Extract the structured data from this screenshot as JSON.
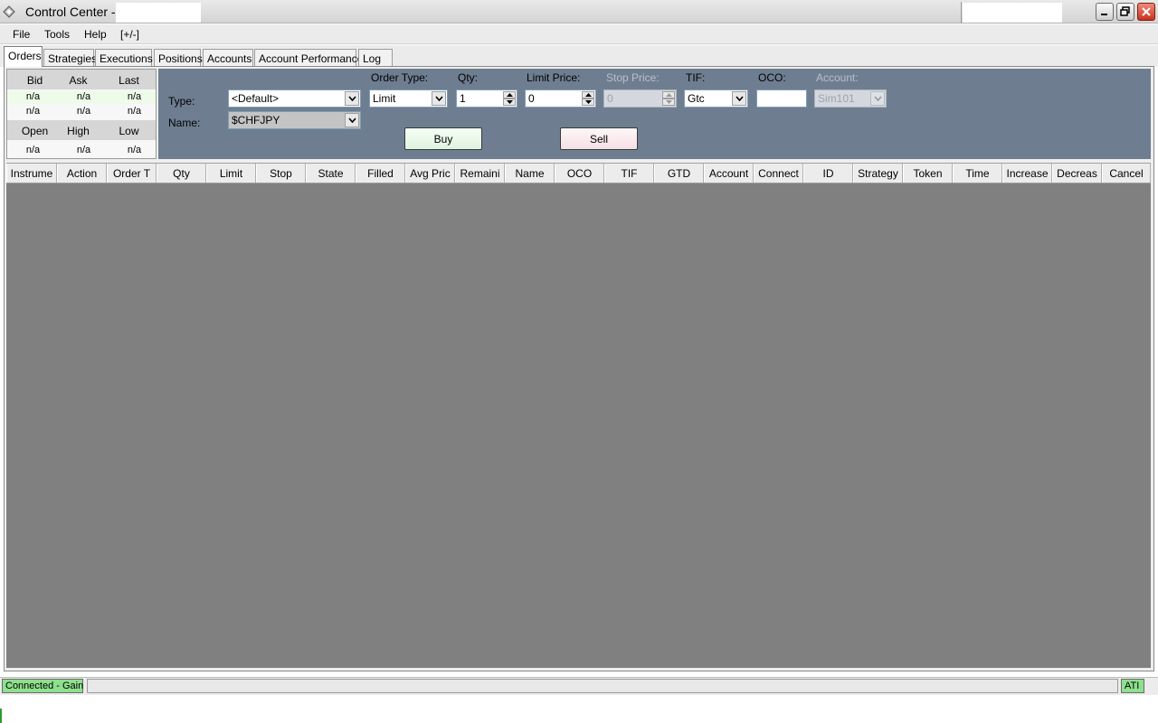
{
  "window": {
    "title": "Control Center -"
  },
  "menu": {
    "items": [
      "File",
      "Tools",
      "Help",
      "[+/-]"
    ]
  },
  "tabs": [
    "Orders",
    "Strategies",
    "Executions",
    "Positions",
    "Accounts",
    "Account Performance",
    "Log"
  ],
  "market": {
    "headers_top": [
      "Bid",
      "Ask",
      "Last"
    ],
    "row1": [
      "n/a",
      "n/a",
      "n/a"
    ],
    "row2": [
      "n/a",
      "n/a",
      "n/a"
    ],
    "headers_bottom": [
      "Open",
      "High",
      "Low"
    ],
    "row3": [
      "n/a",
      "n/a",
      "n/a"
    ]
  },
  "order_entry": {
    "type_label": "Type:",
    "type_value": "<Default>",
    "name_label": "Name:",
    "name_value": "$CHFJPY",
    "order_type_label": "Order Type:",
    "order_type_value": "Limit",
    "qty_label": "Qty:",
    "qty_value": "1",
    "limit_price_label": "Limit Price:",
    "limit_price_value": "0",
    "stop_price_label": "Stop Price:",
    "stop_price_value": "0",
    "tif_label": "TIF:",
    "tif_value": "Gtc",
    "oco_label": "OCO:",
    "oco_value": "",
    "account_label": "Account:",
    "account_value": "Sim101",
    "buy_label": "Buy",
    "sell_label": "Sell"
  },
  "grid": {
    "columns": [
      "Instrume",
      "Action",
      "Order T",
      "Qty",
      "Limit",
      "Stop",
      "State",
      "Filled",
      "Avg Pric",
      "Remaini",
      "Name",
      "OCO",
      "TIF",
      "GTD",
      "Account",
      "Connect",
      "ID",
      "Strategy",
      "Token",
      "Time",
      "Increase",
      "Decreas",
      "Cancel"
    ]
  },
  "status": {
    "connection": "Connected - Gain",
    "provider": "ATI"
  },
  "colors": {
    "order_panel": "#6e7e90",
    "grid_body": "#808080",
    "status_green": "#8ee08e"
  },
  "icons": [
    "app-icon",
    "minimize-icon",
    "restore-icon",
    "close-icon",
    "chevron-down-icon",
    "spin-up-icon",
    "spin-down-icon"
  ]
}
